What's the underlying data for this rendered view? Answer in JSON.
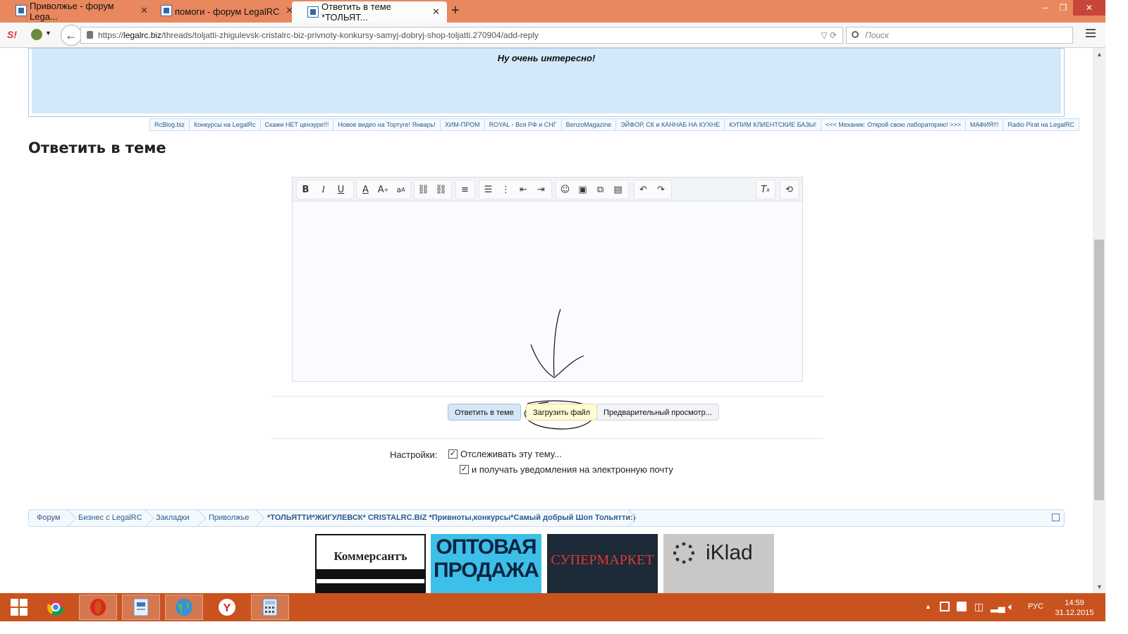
{
  "browser": {
    "tabs": [
      {
        "title": "Приволжье - форум Lega..."
      },
      {
        "title": "помоги - форум LegalRC"
      },
      {
        "title": "Ответить в теме *ТОЛЬЯТ..."
      }
    ],
    "url_prefix": "https://",
    "url_domain": "legalrc.biz",
    "url_path": "/threads/toljatti-zhigulevsk-cristalrc-biz-privnoty-konkursy-samyj-dobryj-shop-toljatti.270904/add-reply",
    "search_placeholder": "Поиск"
  },
  "banner": {
    "text": "Ну очень интересно!"
  },
  "links_strip": [
    "RcBlog.biz",
    "Конкурсы на LegalRc",
    "Скажи НЕТ цензуре!!!",
    "Новое видео на Тортуге! Январь!",
    "ХИМ-ПРОМ",
    "ROYAL - Вся РФ и СНГ",
    "BenzoMagazine",
    "ЭЙФОР, СК и КАННАБ НА КУХНЕ",
    "КУПИМ КЛИЕНТСКИЕ БАЗЫ!",
    "<<< Механик: Открой свою лабораторию! >>>",
    "МАФИЯ!!!",
    "Radio Pirat на LegalRC"
  ],
  "heading": "Ответить в теме",
  "buttons": {
    "reply": "Ответить в теме",
    "upload": "Загрузить файл",
    "preview": "Предварительный просмотр..."
  },
  "settings": {
    "label": "Настройки:",
    "watch": "Отслеживать эту тему...",
    "email": "и получать уведомления на электронную почту"
  },
  "breadcrumb": [
    "Форум",
    "Бизнес с LegalRC",
    "Закладки",
    "Приволжье",
    "*ТОЛЬЯТТИ*ЖИГУЛЕВСК* CRISTALRC.BIZ *Привноты,конкурсы*Самый добрый Шоп Тольятти:)"
  ],
  "ads": {
    "kommersant": "Коммерсантъ",
    "optovaya": "ОПТОВАЯ ПРОДАЖА",
    "supermarket": "СУПЕРМАРКЕТ",
    "iklad": "iKlad"
  },
  "taskbar": {
    "language": "РУС",
    "time": "14:59",
    "date": "31.12.2015"
  },
  "colors": {
    "tabbar": "#e9875e",
    "taskbar": "#c9531f",
    "banner_bg": "#d3e8fa",
    "link": "#2d5b8a"
  }
}
